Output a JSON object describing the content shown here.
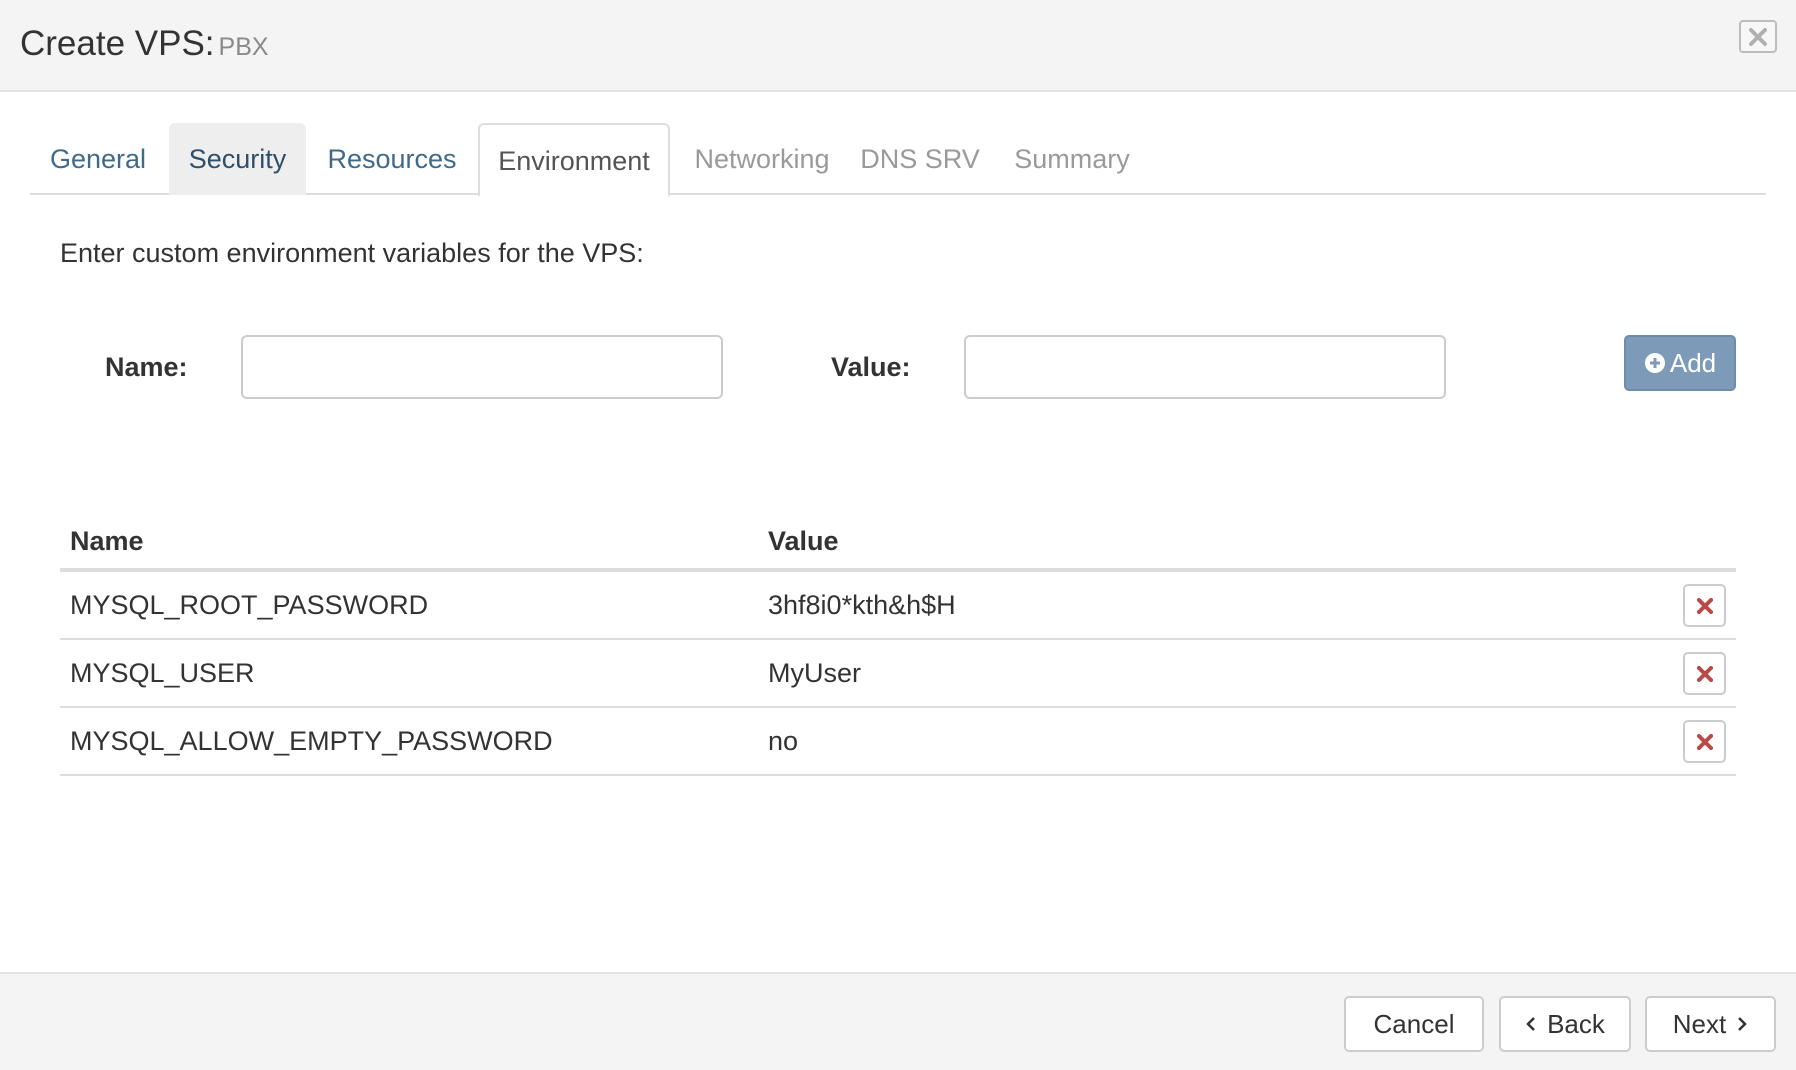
{
  "header": {
    "title": "Create VPS:",
    "subtitle": "PBX",
    "close_icon": "close-icon"
  },
  "tabs": [
    {
      "label": "General",
      "state": "link"
    },
    {
      "label": "Security",
      "state": "hover"
    },
    {
      "label": "Resources",
      "state": "link"
    },
    {
      "label": "Environment",
      "state": "active"
    },
    {
      "label": "Networking",
      "state": "disabled"
    },
    {
      "label": "DNS SRV",
      "state": "disabled"
    },
    {
      "label": "Summary",
      "state": "disabled"
    }
  ],
  "form": {
    "intro": "Enter custom environment variables for the VPS:",
    "name_label": "Name:",
    "name_value": "",
    "value_label": "Value:",
    "value_value": "",
    "add_label": "Add",
    "add_icon": "plus-circle-icon"
  },
  "table": {
    "headers": [
      "Name",
      "Value"
    ],
    "rows": [
      {
        "name": "MYSQL_ROOT_PASSWORD",
        "value": "3hf8i0*kth&h$H"
      },
      {
        "name": "MYSQL_USER",
        "value": "MyUser"
      },
      {
        "name": "MYSQL_ALLOW_EMPTY_PASSWORD",
        "value": "no"
      }
    ],
    "delete_icon": "remove-icon"
  },
  "footer": {
    "cancel_label": "Cancel",
    "back_label": "Back",
    "next_label": "Next"
  },
  "colors": {
    "tab_link": "#3f6a8a",
    "tab_disabled": "#9a9a9a",
    "add_button": "#7d9bb8",
    "delete_icon": "#b94a48"
  }
}
